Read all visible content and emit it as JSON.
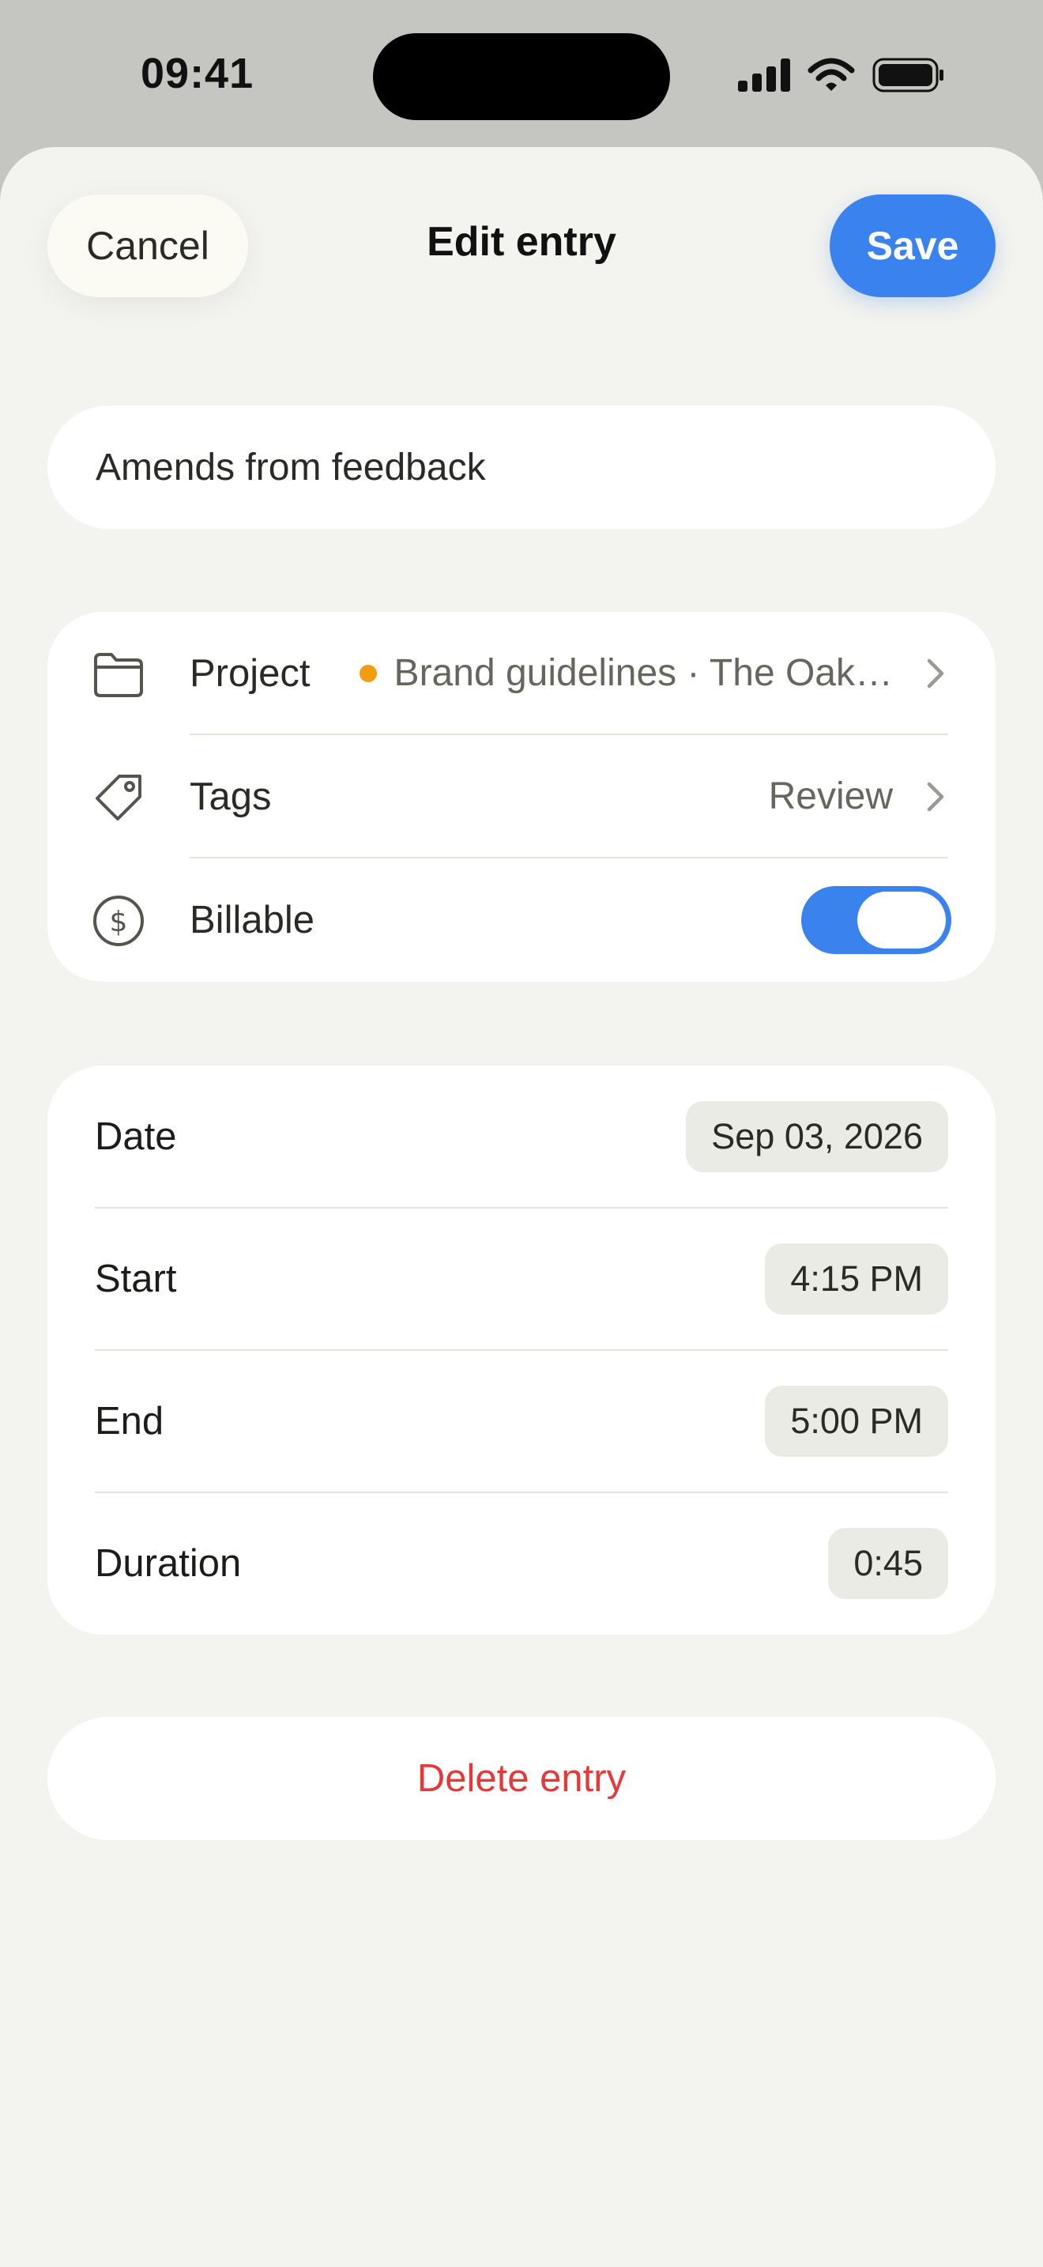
{
  "status_bar": {
    "time": "09:41"
  },
  "header": {
    "title": "Edit entry",
    "cancel_label": "Cancel",
    "save_label": "Save"
  },
  "entry": {
    "description": "Amends from feedback"
  },
  "properties": {
    "project": {
      "label": "Project",
      "value": "Brand guidelines · The Oak…",
      "dot_color": "#f39c12"
    },
    "tags": {
      "label": "Tags",
      "value": "Review"
    },
    "billable": {
      "label": "Billable",
      "on": true
    }
  },
  "time": {
    "date": {
      "label": "Date",
      "value": "Sep 03, 2026"
    },
    "start": {
      "label": "Start",
      "value": "4:15 PM"
    },
    "end": {
      "label": "End",
      "value": "5:00 PM"
    },
    "duration": {
      "label": "Duration",
      "value": "0:45"
    }
  },
  "actions": {
    "delete_label": "Delete entry"
  },
  "colors": {
    "accent": "#3a82ee",
    "danger": "#e5383b",
    "background": "#f3f3ef"
  }
}
